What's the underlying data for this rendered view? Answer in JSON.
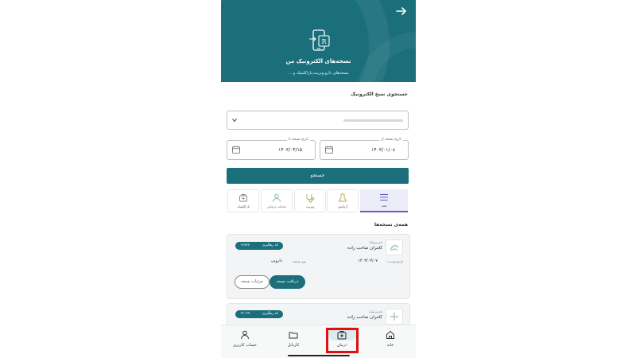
{
  "header": {
    "title": "نسخه‌های الکترونیک من",
    "subtitle": "نسخه‌های دارو،ویزیت،پاراکلینیک و ..."
  },
  "search": {
    "section_title": "جستجوی نسخ الکترونیک",
    "date_from_label": "تاریخ نسخه از",
    "date_from_value": "۱۴۰۳/۰۱/۰۸",
    "date_to_label": "تاریخ نسخه تا",
    "date_to_value": "۱۴۰۳/۰۴/۱۵",
    "button_label": "جستجو"
  },
  "tabs": [
    {
      "label": "همه",
      "icon": "menu-icon"
    },
    {
      "label": "آزمایش",
      "icon": "lab-icon"
    },
    {
      "label": "ویزیت",
      "icon": "stethoscope-icon"
    },
    {
      "label": "خدمات درمانی",
      "icon": "user-icon"
    },
    {
      "label": "پاراکلینیک",
      "icon": "medical-icon"
    }
  ],
  "list": {
    "title": "همه‌ی نسخه‌ها"
  },
  "cards": [
    {
      "doctor_label": "نام پزشک:",
      "doctor_name": "کامران صاحب زاده",
      "tracking_label": "کد رهگیری",
      "tracking_number": "۱۲۸۷۷",
      "visit_date_label": "تاریخ ویزیت:",
      "visit_date": "۱۴۰۳/۰۳/۰۷",
      "type_label": "نوع نسخه:",
      "type_value": "دارویی",
      "receive_button": "دریافت نسخه",
      "details_button": "جزئیات نسخه"
    },
    {
      "doctor_label": "نام پزشک:",
      "doctor_name": "کامران صاحب زاده",
      "tracking_label": "کد رهگیری",
      "tracking_number": "۱۴۰۳۹"
    }
  ],
  "bottom_nav": [
    {
      "label": "خانه",
      "icon": "home-icon"
    },
    {
      "label": "درمان",
      "icon": "medical-bag-icon",
      "active": true
    },
    {
      "label": "کارتابل",
      "icon": "folder-icon"
    },
    {
      "label": "حساب کاربری",
      "icon": "user-icon"
    }
  ],
  "colors": {
    "primary": "#1b6f7b",
    "active_tab": "#6b5bc2",
    "highlight_box": "#e01010"
  }
}
